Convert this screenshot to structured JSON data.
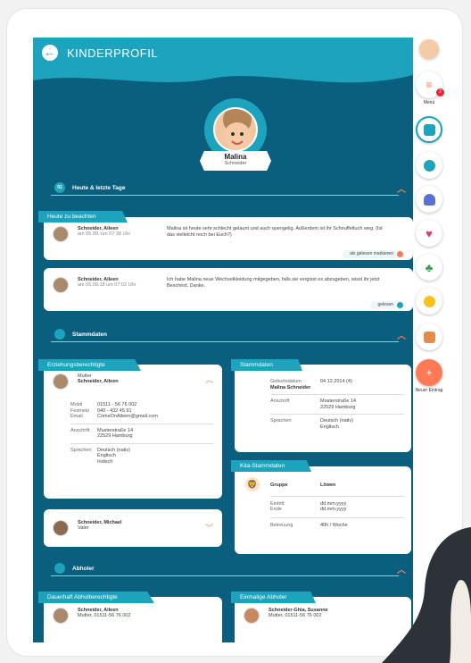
{
  "header": {
    "title": "KINDERPROFIL"
  },
  "child": {
    "name": "Malina",
    "surname": "Schneider"
  },
  "sections": {
    "today": "Heute & letzte Tage",
    "master": "Stammdaten",
    "pickup": "Abholer"
  },
  "today": {
    "ribbon": "Heute zu beachten",
    "messages": [
      {
        "author": "Schneider, Aileen",
        "time": "am 05.09. um 07:38 Uhr",
        "text": "Malina ist heute sehr schlecht gelaunt und auch quengelig. Außerdem ist ihr Schnuffeltuch weg. (Ist das vielleicht noch bei Euch?)",
        "status": "als gelesen markieren"
      },
      {
        "author": "Schneider, Aileen",
        "time": "am 05.09.18 um 07:02 Uhr",
        "text": "Ich habe Malina neue Wechselkleidung mitgegeben, falls sie vergisst es abzugeben, wisst ihr jetzt Bescheid. Danke.",
        "status": "gelesen"
      }
    ]
  },
  "guardians": {
    "ribbon": "Erziehungsberechtigte",
    "primary": {
      "role": "Mutter",
      "name": "Schneider, Aileen",
      "mobil_label": "Mobil",
      "mobil": "01511 - 56 76 002",
      "festnetz_label": "Festnetz",
      "festnetz": "040 - 432 45 91",
      "email_label": "Email",
      "email": "ComeOnAileen@gmail.com",
      "address_label": "Anschrift",
      "address1": "Musterstraße 14",
      "address2": "22529 Hamburg",
      "lang_label": "Sprachen",
      "lang1": "Deutsch (nativ)",
      "lang2": "Englisch",
      "lang3": "Indisch"
    },
    "secondary": {
      "name": "Schneider, Michael",
      "role": "Vater"
    }
  },
  "master": {
    "ribbon": "Stammdaten",
    "birth_label": "Geburtsdatum",
    "birth": "04.12.2014 (4)",
    "full_name": "Malina Schneider",
    "address_label": "Anschrift",
    "address1": "Musterstraße 14",
    "address2": "22529 Hamburg",
    "lang_label": "Sprachen",
    "lang1": "Deutsch (nativ)",
    "lang2": "Englisch"
  },
  "kita": {
    "ribbon": "Kita-Stammdaten",
    "group_label": "Gruppe",
    "group": "Löwen",
    "entry_label": "Eintritt",
    "entry": "dd.mm.yyyy",
    "end_label": "Ende",
    "end": "dd.mm.yyyy",
    "care_label": "Betreuung",
    "care": "40h / Woche"
  },
  "pickup": {
    "permanent": {
      "ribbon": "Dauerhaft Abholberechtigte",
      "name": "Schneider, Aileen",
      "detail": "Mutter, 01511-56 76 002"
    },
    "once": {
      "ribbon": "Einmalige Abholer",
      "name": "Schneider-Ghia, Susanne",
      "detail": "Mutter, 01511-56 76 002"
    }
  },
  "sidebar": {
    "menu": "Menü",
    "badge": "2",
    "new": "Neuer Eintrag",
    "plus": "+"
  },
  "colors": {
    "teal": "#1da3bd",
    "navy": "#0a5f7f",
    "accent": "#ff7a55"
  }
}
